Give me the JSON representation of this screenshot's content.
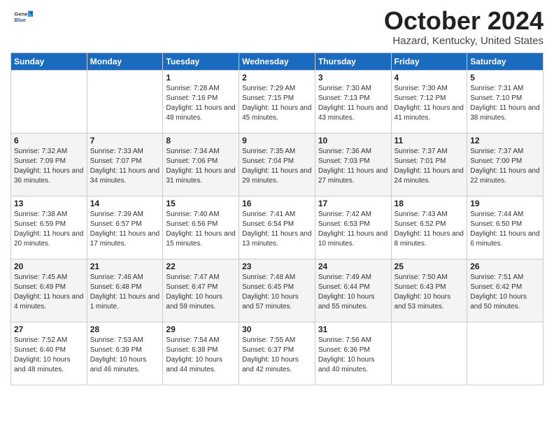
{
  "header": {
    "logo": {
      "general": "General",
      "blue": "Blue"
    },
    "title": "October 2024",
    "location": "Hazard, Kentucky, United States"
  },
  "days_of_week": [
    "Sunday",
    "Monday",
    "Tuesday",
    "Wednesday",
    "Thursday",
    "Friday",
    "Saturday"
  ],
  "weeks": [
    [
      {
        "num": "",
        "info": ""
      },
      {
        "num": "",
        "info": ""
      },
      {
        "num": "1",
        "info": "Sunrise: 7:28 AM\nSunset: 7:16 PM\nDaylight: 11 hours and 48 minutes."
      },
      {
        "num": "2",
        "info": "Sunrise: 7:29 AM\nSunset: 7:15 PM\nDaylight: 11 hours and 45 minutes."
      },
      {
        "num": "3",
        "info": "Sunrise: 7:30 AM\nSunset: 7:13 PM\nDaylight: 11 hours and 43 minutes."
      },
      {
        "num": "4",
        "info": "Sunrise: 7:30 AM\nSunset: 7:12 PM\nDaylight: 11 hours and 41 minutes."
      },
      {
        "num": "5",
        "info": "Sunrise: 7:31 AM\nSunset: 7:10 PM\nDaylight: 11 hours and 38 minutes."
      }
    ],
    [
      {
        "num": "6",
        "info": "Sunrise: 7:32 AM\nSunset: 7:09 PM\nDaylight: 11 hours and 36 minutes."
      },
      {
        "num": "7",
        "info": "Sunrise: 7:33 AM\nSunset: 7:07 PM\nDaylight: 11 hours and 34 minutes."
      },
      {
        "num": "8",
        "info": "Sunrise: 7:34 AM\nSunset: 7:06 PM\nDaylight: 11 hours and 31 minutes."
      },
      {
        "num": "9",
        "info": "Sunrise: 7:35 AM\nSunset: 7:04 PM\nDaylight: 11 hours and 29 minutes."
      },
      {
        "num": "10",
        "info": "Sunrise: 7:36 AM\nSunset: 7:03 PM\nDaylight: 11 hours and 27 minutes."
      },
      {
        "num": "11",
        "info": "Sunrise: 7:37 AM\nSunset: 7:01 PM\nDaylight: 11 hours and 24 minutes."
      },
      {
        "num": "12",
        "info": "Sunrise: 7:37 AM\nSunset: 7:00 PM\nDaylight: 11 hours and 22 minutes."
      }
    ],
    [
      {
        "num": "13",
        "info": "Sunrise: 7:38 AM\nSunset: 6:59 PM\nDaylight: 11 hours and 20 minutes."
      },
      {
        "num": "14",
        "info": "Sunrise: 7:39 AM\nSunset: 6:57 PM\nDaylight: 11 hours and 17 minutes."
      },
      {
        "num": "15",
        "info": "Sunrise: 7:40 AM\nSunset: 6:56 PM\nDaylight: 11 hours and 15 minutes."
      },
      {
        "num": "16",
        "info": "Sunrise: 7:41 AM\nSunset: 6:54 PM\nDaylight: 11 hours and 13 minutes."
      },
      {
        "num": "17",
        "info": "Sunrise: 7:42 AM\nSunset: 6:53 PM\nDaylight: 11 hours and 10 minutes."
      },
      {
        "num": "18",
        "info": "Sunrise: 7:43 AM\nSunset: 6:52 PM\nDaylight: 11 hours and 8 minutes."
      },
      {
        "num": "19",
        "info": "Sunrise: 7:44 AM\nSunset: 6:50 PM\nDaylight: 11 hours and 6 minutes."
      }
    ],
    [
      {
        "num": "20",
        "info": "Sunrise: 7:45 AM\nSunset: 6:49 PM\nDaylight: 11 hours and 4 minutes."
      },
      {
        "num": "21",
        "info": "Sunrise: 7:46 AM\nSunset: 6:48 PM\nDaylight: 11 hours and 1 minute."
      },
      {
        "num": "22",
        "info": "Sunrise: 7:47 AM\nSunset: 6:47 PM\nDaylight: 10 hours and 59 minutes."
      },
      {
        "num": "23",
        "info": "Sunrise: 7:48 AM\nSunset: 6:45 PM\nDaylight: 10 hours and 57 minutes."
      },
      {
        "num": "24",
        "info": "Sunrise: 7:49 AM\nSunset: 6:44 PM\nDaylight: 10 hours and 55 minutes."
      },
      {
        "num": "25",
        "info": "Sunrise: 7:50 AM\nSunset: 6:43 PM\nDaylight: 10 hours and 53 minutes."
      },
      {
        "num": "26",
        "info": "Sunrise: 7:51 AM\nSunset: 6:42 PM\nDaylight: 10 hours and 50 minutes."
      }
    ],
    [
      {
        "num": "27",
        "info": "Sunrise: 7:52 AM\nSunset: 6:40 PM\nDaylight: 10 hours and 48 minutes."
      },
      {
        "num": "28",
        "info": "Sunrise: 7:53 AM\nSunset: 6:39 PM\nDaylight: 10 hours and 46 minutes."
      },
      {
        "num": "29",
        "info": "Sunrise: 7:54 AM\nSunset: 6:38 PM\nDaylight: 10 hours and 44 minutes."
      },
      {
        "num": "30",
        "info": "Sunrise: 7:55 AM\nSunset: 6:37 PM\nDaylight: 10 hours and 42 minutes."
      },
      {
        "num": "31",
        "info": "Sunrise: 7:56 AM\nSunset: 6:36 PM\nDaylight: 10 hours and 40 minutes."
      },
      {
        "num": "",
        "info": ""
      },
      {
        "num": "",
        "info": ""
      }
    ]
  ]
}
